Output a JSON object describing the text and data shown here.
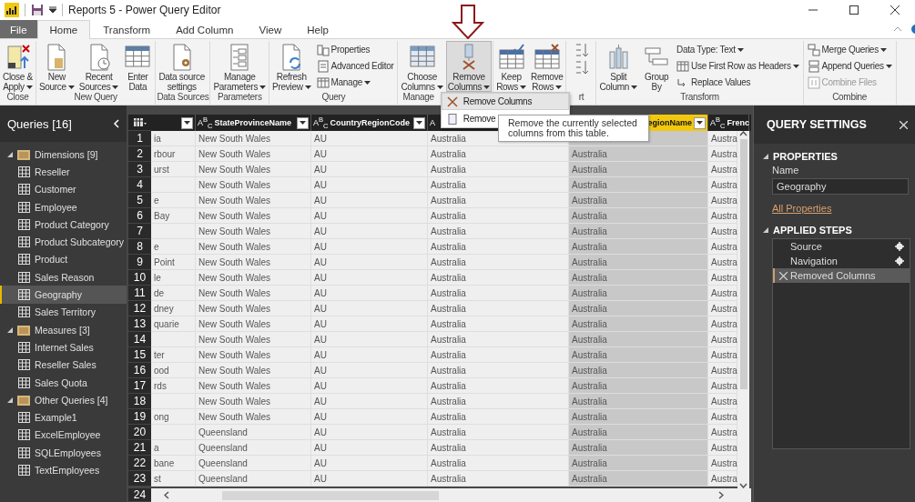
{
  "window": {
    "title": "Reports 5 - Power Query Editor"
  },
  "ribbon_tabs": [
    {
      "label": "File",
      "kind": "file",
      "selected": false
    },
    {
      "label": "Home",
      "kind": "tab",
      "selected": true
    },
    {
      "label": "Transform",
      "kind": "tab",
      "selected": false
    },
    {
      "label": "Add Column",
      "kind": "tab",
      "selected": false
    },
    {
      "label": "View",
      "kind": "tab",
      "selected": false
    },
    {
      "label": "Help",
      "kind": "tab",
      "selected": false
    }
  ],
  "ribbon_groups": [
    {
      "label": "Close",
      "items": [
        {
          "kind": "large",
          "lines": [
            "Close &",
            "Apply"
          ],
          "dropdown": true,
          "pressed": false
        }
      ]
    },
    {
      "label": "New Query",
      "items": [
        {
          "kind": "large",
          "lines": [
            "New",
            "Source"
          ],
          "dropdown": true,
          "pressed": false
        },
        {
          "kind": "large",
          "lines": [
            "Recent",
            "Sources"
          ],
          "dropdown": true,
          "pressed": false
        },
        {
          "kind": "large",
          "lines": [
            "Enter",
            "Data"
          ],
          "dropdown": false,
          "pressed": false
        }
      ]
    },
    {
      "label": "Data Sources",
      "items": [
        {
          "kind": "large",
          "lines": [
            "Data source",
            "settings"
          ],
          "dropdown": false,
          "pressed": false
        }
      ]
    },
    {
      "label": "Parameters",
      "items": [
        {
          "kind": "large",
          "lines": [
            "Manage",
            "Parameters"
          ],
          "dropdown": true,
          "pressed": false
        }
      ]
    },
    {
      "label": "Query",
      "items": [
        {
          "kind": "large",
          "lines": [
            "Refresh",
            "Preview"
          ],
          "dropdown": true,
          "pressed": false
        },
        {
          "kind": "stack",
          "entries": [
            {
              "label": "Properties",
              "dropdown": false,
              "disabled": false
            },
            {
              "label": "Advanced Editor",
              "dropdown": false,
              "disabled": false
            },
            {
              "label": "Manage",
              "dropdown": true,
              "disabled": false
            }
          ]
        }
      ]
    },
    {
      "label": "Manage",
      "items": [
        {
          "kind": "large",
          "lines": [
            "Choose",
            "Columns"
          ],
          "dropdown": true,
          "pressed": false
        },
        {
          "kind": "large",
          "lines": [
            "Remove",
            "Columns"
          ],
          "dropdown": true,
          "pressed": true
        }
      ]
    },
    {
      "items": [
        {
          "kind": "large",
          "lines": [
            "Keep",
            "Rows"
          ],
          "dropdown": true,
          "pressed": false
        },
        {
          "kind": "large",
          "lines": [
            "Remove",
            "Rows"
          ],
          "dropdown": true,
          "pressed": false
        }
      ]
    },
    {
      "label": "rt",
      "items": [
        {
          "kind": "sort"
        }
      ]
    },
    {
      "label": "Transform",
      "items": [
        {
          "kind": "large",
          "lines": [
            "Split",
            "Column"
          ],
          "dropdown": true,
          "pressed": false
        },
        {
          "kind": "large",
          "lines": [
            "Group",
            "By"
          ],
          "dropdown": false,
          "pressed": false
        },
        {
          "kind": "stack",
          "entries": [
            {
              "label": "Data Type: Text",
              "dropdown": true,
              "disabled": false
            },
            {
              "label": "Use First Row as Headers",
              "dropdown": true,
              "disabled": false
            },
            {
              "label": "Replace Values",
              "dropdown": false,
              "disabled": false
            }
          ]
        }
      ]
    },
    {
      "label": "Combine",
      "items": [
        {
          "kind": "stack",
          "entries": [
            {
              "label": "Merge Queries",
              "dropdown": true,
              "disabled": false
            },
            {
              "label": "Append Queries",
              "dropdown": true,
              "disabled": false
            },
            {
              "label": "Combine Files",
              "dropdown": false,
              "disabled": true
            }
          ]
        }
      ]
    }
  ],
  "dropdown_menu": {
    "items": [
      {
        "label": "Remove Columns",
        "selected": true
      },
      {
        "label": "Remove",
        "selected": false
      }
    ]
  },
  "tooltip": {
    "text": "Remove the currently selected columns from this table."
  },
  "queries": {
    "title": "Queries [16]",
    "groups": [
      {
        "label": "Dimensions [9]",
        "expanded": true,
        "children": [
          {
            "label": "Reseller",
            "selected": false
          },
          {
            "label": "Customer",
            "selected": false
          },
          {
            "label": "Employee",
            "selected": false
          },
          {
            "label": "Product Category",
            "selected": false
          },
          {
            "label": "Product Subcategory",
            "selected": false
          },
          {
            "label": "Product",
            "selected": false
          },
          {
            "label": "Sales Reason",
            "selected": false
          },
          {
            "label": "Geography",
            "selected": true
          },
          {
            "label": "Sales Territory",
            "selected": false
          }
        ]
      },
      {
        "label": "Measures [3]",
        "expanded": true,
        "children": [
          {
            "label": "Internet Sales",
            "selected": false
          },
          {
            "label": "Reseller Sales",
            "selected": false
          },
          {
            "label": "Sales Quota",
            "selected": false
          }
        ]
      },
      {
        "label": "Other Queries [4]",
        "expanded": true,
        "children": [
          {
            "label": "Example1",
            "selected": false
          },
          {
            "label": "ExcelEmployee",
            "selected": false
          },
          {
            "label": "SQLEmployees",
            "selected": false
          },
          {
            "label": "TextEmployees",
            "selected": false
          }
        ]
      }
    ]
  },
  "table": {
    "columns": [
      {
        "dropdown": true,
        "selected": false
      },
      {
        "type_label": "A$^{B}$$_{C}$",
        "label": "StateProvinceName",
        "dropdown": true,
        "selected": false
      },
      {
        "type_label": "A$^{B}$$_{C}$",
        "label": "CountryRegionCode",
        "dropdown": true,
        "selected": false
      },
      {
        "type_label": "A",
        "dropdown": false,
        "selected": false
      },
      {
        "label": "egionName",
        "dropdown": true,
        "selected": true
      },
      {
        "type_label": "A$^{B}$$_{C}$",
        "label": "Frenc",
        "selected": false
      }
    ],
    "rows": [
      {
        "number": "1",
        "cells": [
          "ia",
          "New South Wales",
          "AU",
          "Australia",
          null,
          "Austra"
        ]
      },
      {
        "number": "2",
        "cells": [
          "rbour",
          "New South Wales",
          "AU",
          "Australia",
          "Australia",
          "Austra"
        ]
      },
      {
        "number": "3",
        "cells": [
          "urst",
          "New South Wales",
          "AU",
          "Australia",
          "Australia",
          "Austra"
        ]
      },
      {
        "number": "4",
        "cells": [
          null,
          "New South Wales",
          "AU",
          "Australia",
          "Australia",
          "Austra"
        ]
      },
      {
        "number": "5",
        "cells": [
          "e",
          "New South Wales",
          "AU",
          "Australia",
          "Australia",
          "Austra"
        ]
      },
      {
        "number": "6",
        "cells": [
          "Bay",
          "New South Wales",
          "AU",
          "Australia",
          "Australia",
          "Austra"
        ]
      },
      {
        "number": "7",
        "cells": [
          null,
          "New South Wales",
          "AU",
          "Australia",
          "Australia",
          "Austra"
        ]
      },
      {
        "number": "8",
        "cells": [
          "e",
          "New South Wales",
          "AU",
          "Australia",
          "Australia",
          "Austra"
        ]
      },
      {
        "number": "9",
        "cells": [
          "Point",
          "New South Wales",
          "AU",
          "Australia",
          "Australia",
          "Austra"
        ]
      },
      {
        "number": "10",
        "cells": [
          "le",
          "New South Wales",
          "AU",
          "Australia",
          "Australia",
          "Austra"
        ]
      },
      {
        "number": "11",
        "cells": [
          "de",
          "New South Wales",
          "AU",
          "Australia",
          "Australia",
          "Austra"
        ]
      },
      {
        "number": "12",
        "cells": [
          "dney",
          "New South Wales",
          "AU",
          "Australia",
          "Australia",
          "Austra"
        ]
      },
      {
        "number": "13",
        "cells": [
          "quarie",
          "New South Wales",
          "AU",
          "Australia",
          "Australia",
          "Austra"
        ]
      },
      {
        "number": "14",
        "cells": [
          null,
          "New South Wales",
          "AU",
          "Australia",
          "Australia",
          "Austra"
        ]
      },
      {
        "number": "15",
        "cells": [
          "ter",
          "New South Wales",
          "AU",
          "Australia",
          "Australia",
          "Austra"
        ]
      },
      {
        "number": "16",
        "cells": [
          "ood",
          "New South Wales",
          "AU",
          "Australia",
          "Australia",
          "Austra"
        ]
      },
      {
        "number": "17",
        "cells": [
          "rds",
          "New South Wales",
          "AU",
          "Australia",
          "Australia",
          "Austra"
        ]
      },
      {
        "number": "18",
        "cells": [
          null,
          "New South Wales",
          "AU",
          "Australia",
          "Australia",
          "Austra"
        ]
      },
      {
        "number": "19",
        "cells": [
          "ong",
          "New South Wales",
          "AU",
          "Australia",
          "Australia",
          "Austra"
        ]
      },
      {
        "number": "20",
        "cells": [
          null,
          "Queensland",
          "AU",
          "Australia",
          "Australia",
          "Austra"
        ]
      },
      {
        "number": "21",
        "cells": [
          "a",
          "Queensland",
          "AU",
          "Australia",
          "Australia",
          "Austra"
        ]
      },
      {
        "number": "22",
        "cells": [
          "bane",
          "Queensland",
          "AU",
          "Australia",
          "Australia",
          "Austra"
        ]
      },
      {
        "number": "23",
        "cells": [
          "st",
          "Queensland",
          "AU",
          "Australia",
          "Australia",
          "Austra"
        ]
      }
    ],
    "last_row_number": "24"
  },
  "query_settings": {
    "title": "QUERY SETTINGS",
    "properties": {
      "heading": "PROPERTIES",
      "expanded": true,
      "name_label": "Name",
      "name_value": "Geography",
      "link": "All Properties"
    },
    "applied_steps": {
      "heading": "APPLIED STEPS",
      "expanded": true,
      "steps": [
        {
          "label": "Source",
          "selected": false,
          "settings": true
        },
        {
          "label": "Navigation",
          "selected": false,
          "settings": true
        },
        {
          "label": "Removed Columns",
          "selected": true,
          "settings": false
        }
      ]
    }
  }
}
